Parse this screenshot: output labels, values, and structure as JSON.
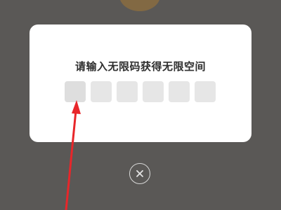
{
  "dialog": {
    "title": "请输入无限码获得无限空间",
    "code_inputs": [
      {
        "value": ""
      },
      {
        "value": ""
      },
      {
        "value": ""
      },
      {
        "value": ""
      },
      {
        "value": ""
      },
      {
        "value": ""
      }
    ]
  },
  "close_button": {
    "icon": "close-icon"
  },
  "colors": {
    "overlay": "#5a5856",
    "dialog_bg": "#ffffff",
    "code_box": "#e6e6e6",
    "annotation_arrow": "#e8262a"
  }
}
